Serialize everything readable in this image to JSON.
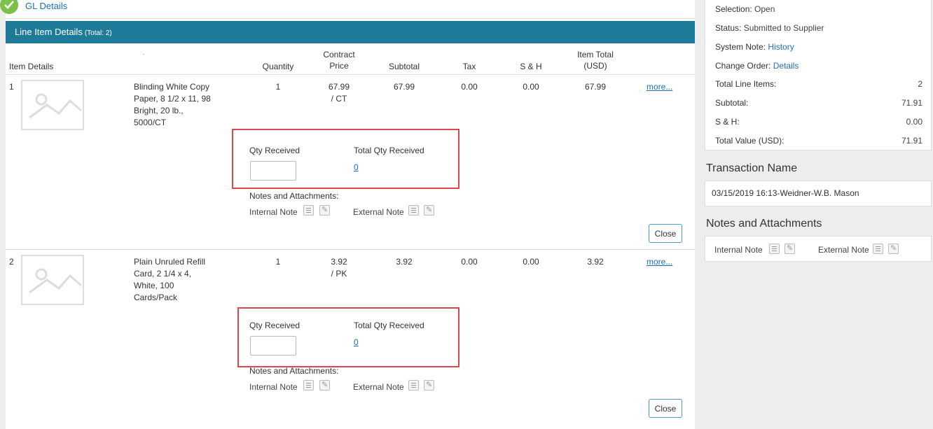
{
  "gl": {
    "label": "GL Details"
  },
  "line_items": {
    "title": "Line Item Details",
    "total": "(Total: 2)",
    "columns": {
      "item_details": "Item Details",
      "quantity": "Quantity",
      "contract_price_1": "Contract",
      "contract_price_2": "Price",
      "subtotal": "Subtotal",
      "tax": "Tax",
      "sh": "S & H",
      "item_total_1": "Item Total",
      "item_total_2": "(USD)",
      "dot": "."
    },
    "items": [
      {
        "num": "1",
        "desc": "Blinding White Copy Paper, 8 1/2 x 11, 98 Bright, 20 lb., 5000/CT",
        "quantity": "1",
        "price": "67.99",
        "unit": "/ CT",
        "subtotal": "67.99",
        "tax": "0.00",
        "sh": "0.00",
        "total": "67.99",
        "more": "more...",
        "qty_received_label": "Qty Received",
        "qty_received_value": "",
        "total_qty_received_label": "Total Qty Received",
        "total_qty_received": "0",
        "notes_label": "Notes and Attachments:",
        "internal_note": "Internal Note",
        "external_note": "External Note",
        "close": "Close"
      },
      {
        "num": "2",
        "desc": "Plain Unruled Refill Card, 2 1/4 x 4, White, 100 Cards/Pack",
        "quantity": "1",
        "price": "3.92",
        "unit": "/ PK",
        "subtotal": "3.92",
        "tax": "0.00",
        "sh": "0.00",
        "total": "3.92",
        "more": "more...",
        "qty_received_label": "Qty Received",
        "qty_received_value": "",
        "total_qty_received_label": "Total Qty Received",
        "total_qty_received": "0",
        "notes_label": "Notes and Attachments:",
        "internal_note": "Internal Note",
        "external_note": "External Note",
        "close": "Close"
      }
    ]
  },
  "summary": {
    "selection_label": "Selection:",
    "selection_value": "Open",
    "status_label": "Status:",
    "status_value": "Submitted to Supplier",
    "system_note_label": "System Note:",
    "system_note_link": "History",
    "change_order_label": "Change Order:",
    "change_order_link": "Details",
    "total_line_items_label": "Total Line Items:",
    "total_line_items": "2",
    "subtotal_label": "Subtotal:",
    "subtotal": "71.91",
    "sh_label": "S & H:",
    "sh": "0.00",
    "total_value_label": "Total Value (USD):",
    "total_value": "71.91"
  },
  "transaction": {
    "title": "Transaction Name",
    "value": "03/15/2019 16:13-Weidner-W.B. Mason"
  },
  "notes_panel": {
    "title": "Notes and Attachments",
    "internal_note": "Internal Note",
    "external_note": "External Note"
  },
  "colors": {
    "header": "#1e7a99",
    "link": "#1e6fb5",
    "highlight": "#e0474c",
    "check": "#7cc04a"
  }
}
